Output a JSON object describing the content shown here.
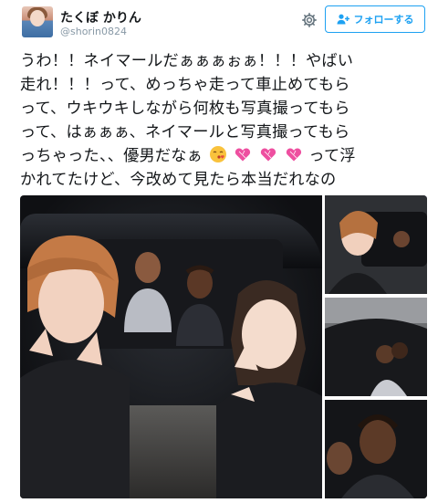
{
  "user": {
    "display_name": "たくぼ かりん",
    "screen_name": "@shorin0824"
  },
  "actions": {
    "follow_label": "フォローする"
  },
  "tweet": {
    "lines": [
      "うわ！！ネイマールだぁぁぁぉぁ！！！やばい",
      "走れ！！！って、めっちゃ走って車止めてもら",
      "って、ウキウキしながら何枚も写真撮ってもら",
      "って、はぁぁぁ、ネイマールと写真撮ってもら"
    ],
    "line5_before_emoji": "っちゃった、、優男だなぁ",
    "line5_after_emoji": "って浮",
    "line6": "かれてたけど、今改めて見たら本当だれなの"
  },
  "icons": {
    "settings": "gear-icon",
    "follow": "add-user-icon",
    "emoji_kiss": "kissing-face-emoji",
    "emoji_heart": "sparkling-heart-emoji"
  },
  "colors": {
    "accent": "#1da1f2",
    "text": "#14171a",
    "muted": "#8899a6"
  }
}
